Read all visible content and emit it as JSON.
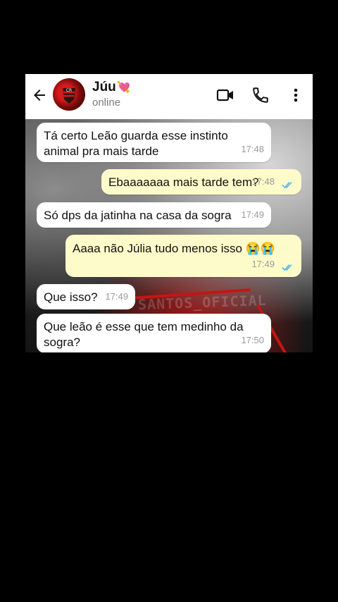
{
  "contact": {
    "name": "Júu",
    "emoji": "💘",
    "status": "online"
  },
  "header_icons": [
    "back-arrow-icon",
    "video-call-icon",
    "voice-call-icon",
    "more-options-icon"
  ],
  "watermark": "SANTOS_OFICIAL",
  "colors": {
    "incoming_bubble": "#ffffff",
    "outgoing_bubble": "#fdfbc9",
    "read_ticks": "#4fb6ec",
    "header_bg": "#ffffff"
  },
  "messages": [
    {
      "direction": "in",
      "text": "Tá certo Leão guarda esse instinto animal pra mais tarde",
      "time": "17:48"
    },
    {
      "direction": "out",
      "text": "Ebaaaaaaa mais tarde tem?",
      "time": "17:48",
      "read": true
    },
    {
      "direction": "in",
      "text": "Só dps da jatinha na casa da sogra",
      "time": "17:49"
    },
    {
      "direction": "out",
      "text": "Aaaa não Júlia tudo menos isso 😭😭",
      "time": "17:49",
      "read": true
    },
    {
      "direction": "in",
      "text": "Que isso?",
      "time": "17:49"
    },
    {
      "direction": "in",
      "text": "Que leão é esse que tem medinho da sogra?",
      "time": "17:50"
    }
  ]
}
